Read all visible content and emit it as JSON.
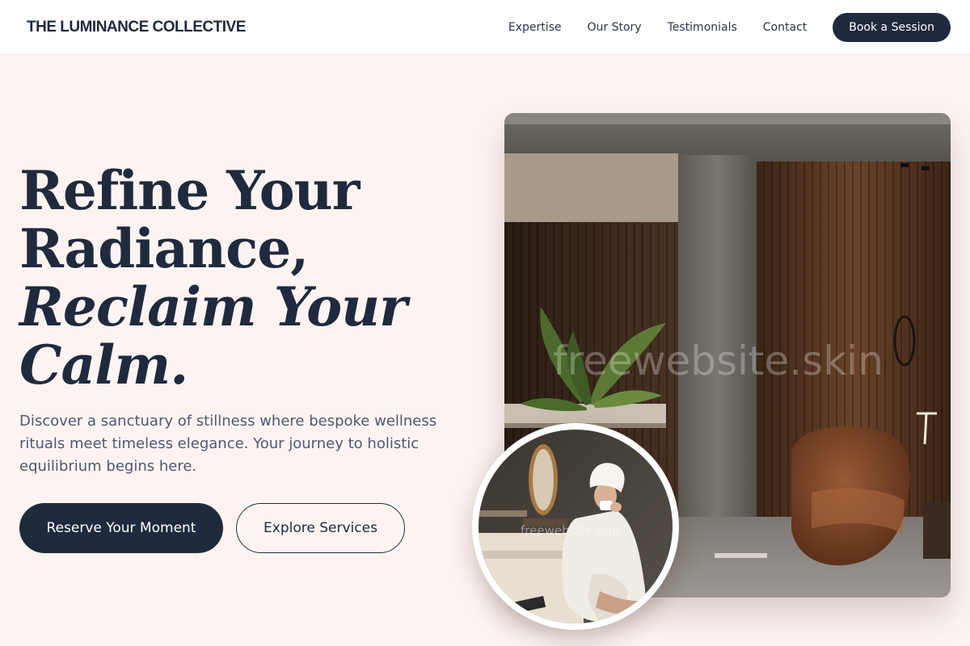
{
  "header": {
    "brand": "THE LUMINANCE COLLECTIVE",
    "nav": [
      "Expertise",
      "Our Story",
      "Testimonials",
      "Contact"
    ],
    "cta": "Book a Session"
  },
  "hero": {
    "title_line1": "Refine Your",
    "title_line2": "Radiance,",
    "title_line3": "Reclaim Your",
    "title_line4": "Calm.",
    "description": "Discover a sanctuary of stillness where bespoke wellness rituals meet timeless elegance. Your journey to holistic equilibrium begins here.",
    "primary_button": "Reserve Your Moment",
    "secondary_button": "Explore Services"
  },
  "images": {
    "watermark": "freewebsite.skin",
    "main_alt": "spa lounge interior",
    "circle_alt": "woman in bathrobe sipping tea"
  },
  "colors": {
    "background": "#fdf4f2",
    "navy": "#1f2a3e",
    "text_muted": "#4e5870",
    "header_bg": "#ffffff"
  }
}
